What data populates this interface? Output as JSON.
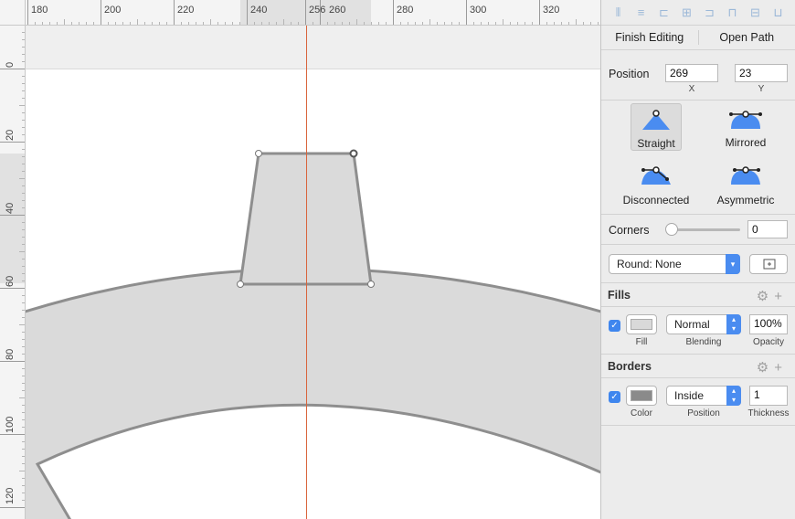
{
  "ruler": {
    "h_labels": [
      "180",
      "200",
      "220",
      "240",
      "256",
      "260",
      "280",
      "300",
      "320"
    ],
    "v_labels": [
      "0",
      "20",
      "40",
      "60",
      "80",
      "100",
      "120"
    ]
  },
  "toolbar": {
    "finish_editing": "Finish Editing",
    "open_path": "Open Path"
  },
  "position": {
    "label": "Position",
    "x_value": "269",
    "y_value": "23",
    "x_caption": "X",
    "y_caption": "Y"
  },
  "point_types": {
    "straight": "Straight",
    "mirrored": "Mirrored",
    "disconnected": "Disconnected",
    "asymmetric": "Asymmetric",
    "selected": "Straight"
  },
  "corners": {
    "label": "Corners",
    "value": "0",
    "slider_fraction": 0
  },
  "round": {
    "value": "Round: None"
  },
  "fills": {
    "header": "Fills",
    "enabled": true,
    "blending": "Normal",
    "opacity": "100%",
    "fill_caption": "Fill",
    "blending_caption": "Blending",
    "opacity_caption": "Opacity",
    "color": "#d9d9d9"
  },
  "borders": {
    "header": "Borders",
    "enabled": true,
    "position": "Inside",
    "thickness": "1",
    "color_caption": "Color",
    "position_caption": "Position",
    "thickness_caption": "Thickness",
    "color": "#8a8a8a"
  },
  "colors": {
    "accent": "#4a8cf0",
    "shape_fill": "#dadada",
    "shape_stroke": "#8e8e8e",
    "guide": "#d9643c"
  }
}
